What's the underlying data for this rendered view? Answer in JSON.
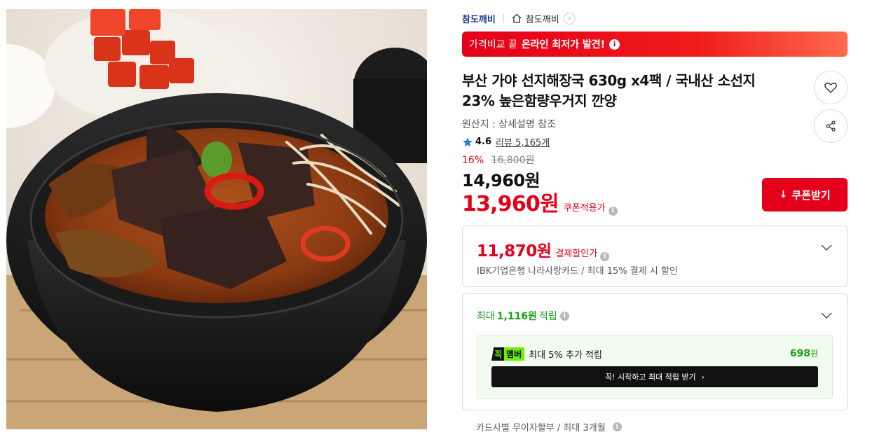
{
  "breadcrumb": {
    "brand": "참도깨비",
    "store": "참도깨비",
    "home_icon": "home-icon",
    "arrow_icon": "chevron-right-icon"
  },
  "price_banner": {
    "prefix": "가격비교 끝",
    "highlight": "온라인 최저가 발견!",
    "info_icon": "i"
  },
  "product": {
    "title_line1": "부산 가야 선지해장국 630g x4팩 / 국내산 소선지",
    "title_line2": "23% 높은함량우거지 깐양",
    "origin": "원산지 : 상세설명 참조",
    "rating": "4.6",
    "review_label": "리뷰 5,165개",
    "discount_rate": "16%",
    "original_price": "16,800원",
    "sale_price": "14,960원",
    "coupon_price": "13,960원",
    "coupon_price_label": "쿠폰적용가"
  },
  "actions": {
    "coupon_button": "쿠폰받기",
    "wishlist_icon": "heart-icon",
    "share_icon": "share-icon"
  },
  "card_discount": {
    "price": "11,870원",
    "label": "결제할인가",
    "description": "IBK기업은행 나라사랑카드 / 최대 15% 결제 시 할인"
  },
  "points": {
    "prefix": "최대",
    "amount": "1,116원",
    "suffix": "적립",
    "member_badge_left": "꼭",
    "member_badge_right": "멤버",
    "member_text": "최대 5% 추가 적립",
    "member_amount": "698",
    "member_amount_unit": "원",
    "member_button": "꼭! 시작하고 최대 적립 받기",
    "member_button_arrow": "›"
  },
  "installment": {
    "text": "카드사별 무이자할부 / 최대 3개월"
  },
  "colors": {
    "accent_red": "#e4001a",
    "points_green": "#1a9e1a",
    "member_lime": "#6cf000",
    "brand_blue": "#1a3d8f"
  }
}
